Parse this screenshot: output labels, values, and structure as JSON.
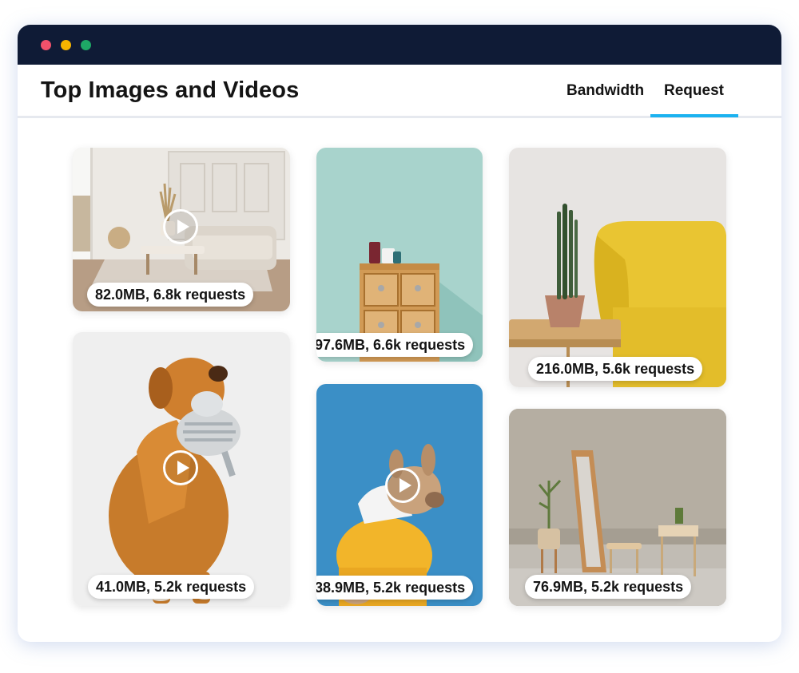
{
  "window": {
    "controls": [
      {
        "name": "close",
        "color": "#f2516b"
      },
      {
        "name": "minimize",
        "color": "#f5b400"
      },
      {
        "name": "maximize",
        "color": "#1ea866"
      }
    ]
  },
  "header": {
    "title": "Top Images and Videos",
    "tabs": [
      {
        "label": "Bandwidth",
        "active": false
      },
      {
        "label": "Request",
        "active": true
      }
    ],
    "accent": "#1bb2f0"
  },
  "media": [
    {
      "stats": "82.0MB, 6.8k requests",
      "type": "video",
      "subject": "living room with sofa"
    },
    {
      "stats": "97.6MB, 6.6k requests",
      "type": "image",
      "subject": "wooden cabinet with mugs"
    },
    {
      "stats": "216.0MB, 5.6k requests",
      "type": "image",
      "subject": "yellow armchair with cactus"
    },
    {
      "stats": "41.0MB, 5.2k requests",
      "type": "video",
      "subject": "dog holding plush toy"
    },
    {
      "stats": "38.9MB, 5.2k requests",
      "type": "video",
      "subject": "french bulldog in yellow hoodie"
    },
    {
      "stats": "76.9MB, 5.2k requests",
      "type": "image",
      "subject": "mirror and wooden furniture"
    }
  ]
}
